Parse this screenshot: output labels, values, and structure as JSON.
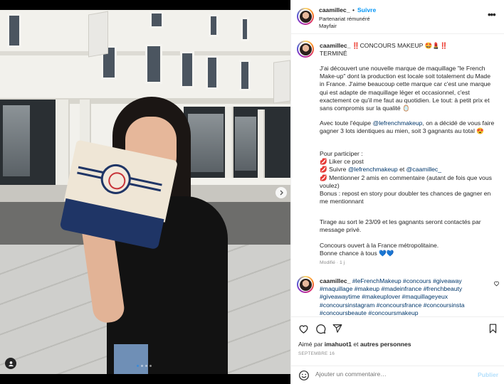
{
  "post": {
    "username": "caamillec_",
    "separator": "•",
    "follow_label": "Suivre",
    "subtitle": "Partenariat rémunéré",
    "location": "Mayfair",
    "more_label": "•••"
  },
  "caption": {
    "username": "caamillec_",
    "title_line": "‼️CONCOURS MAKEUP 🤩💄‼️",
    "title_line2": "TERMINÉ",
    "p1": "J'ai découvert une nouvelle marque de maquillage \"le French Make-up\" dont la production est locale soit totalement du Made in France. J'aime beaucoup cette marque car c'est une marque qui est adapte de maquillage léger et occasionnel, c'est exactement ce qu'il me faut au quotidien. Le tout: à petit prix et sans compromis sur la qualité 🪞",
    "p2_a": "Avec toute l'équipe ",
    "p2_link": "@lefrenchmakeup",
    "p2_b": ", on a décidé de vous faire gagner 3 lots identiques au mien, soit 3 gagnants au total 😍",
    "p3_head": "Pour participer :",
    "p3_l1": "💋 Liker ce post",
    "p3_l2_a": "💋 Suivre ",
    "p3_l2_link1": "@lefrenchmakeup",
    "p3_l2_mid": " et ",
    "p3_l2_link2": "@caamillec_",
    "p3_l3": "💋 Mentionner 2 amis en commentaire (autant de fois que vous voulez)",
    "p3_l4": "Bonus : repost en story pour doubler tes chances de gagner en me mentionnant",
    "p4": "Tirage au sort le 23/09 et les gagnants seront contactés par message privé.",
    "p5": "Concours ouvert à la France métropolitaine.",
    "p6": "Bonne chance à tous 💙💙",
    "meta": "Modifié · 1 j"
  },
  "comment": {
    "username": "caamillec_",
    "hashtags": "#leFrenchMakeup #concours #giveaway #maquillage #makeup #madeinfrance #frenchbeauty #giveawaytime #makeuplover #maquillageyeux #concoursinstagram #concoursfrance #concoursinsta #concoursbeaute #concoursmakeup",
    "like_icon": "heart-outline-icon"
  },
  "actions": {
    "liked_by_prefix": "Aimé par ",
    "liked_by_user": "imahuot1",
    "liked_by_suffix": " et ",
    "liked_by_others": "autres personnes",
    "date": "SEPTEMBRE 16"
  },
  "add_comment": {
    "placeholder": "Ajouter un commentaire…",
    "publish_label": "Publier"
  },
  "carousel": {
    "total": 4,
    "current": 1
  },
  "colors": {
    "accent": "#0095f6",
    "link": "#00376b",
    "muted": "#8e8e8e"
  }
}
